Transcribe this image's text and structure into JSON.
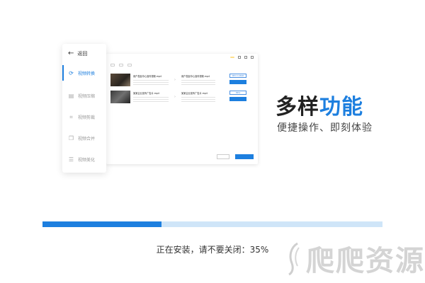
{
  "menu": {
    "back_label": "返回",
    "items": [
      {
        "label": "视频转换",
        "icon": "refresh-icon",
        "active": true
      },
      {
        "label": "视频压缩",
        "icon": "compress-icon",
        "active": false
      },
      {
        "label": "视频剪裁",
        "icon": "crop-icon",
        "active": false
      },
      {
        "label": "视频合并",
        "icon": "merge-icon",
        "active": false
      },
      {
        "label": "视频美化",
        "icon": "adjust-icon",
        "active": false
      }
    ]
  },
  "preview": {
    "files": [
      {
        "source": "用户发起中心宣传视频.mp4",
        "output": "用户发起中心宣传视频.mp4",
        "format": "MP4 1080P"
      },
      {
        "source": "某某企业宣传广告片.mp4",
        "output": "某某企业宣传广告片.mp4",
        "format": "MP4"
      }
    ]
  },
  "headline": {
    "part1": "多样",
    "part2": "功能"
  },
  "subline": "便捷操作、即刻体验",
  "progress": {
    "percent": 35,
    "status_text": "正在安装，请不要关闭：35%"
  },
  "watermark": {
    "text": "爬爬资源"
  },
  "colors": {
    "accent": "#1d7fdf",
    "track": "#cfe5f8",
    "text": "#333333",
    "watermark": "#d4d4d4"
  }
}
